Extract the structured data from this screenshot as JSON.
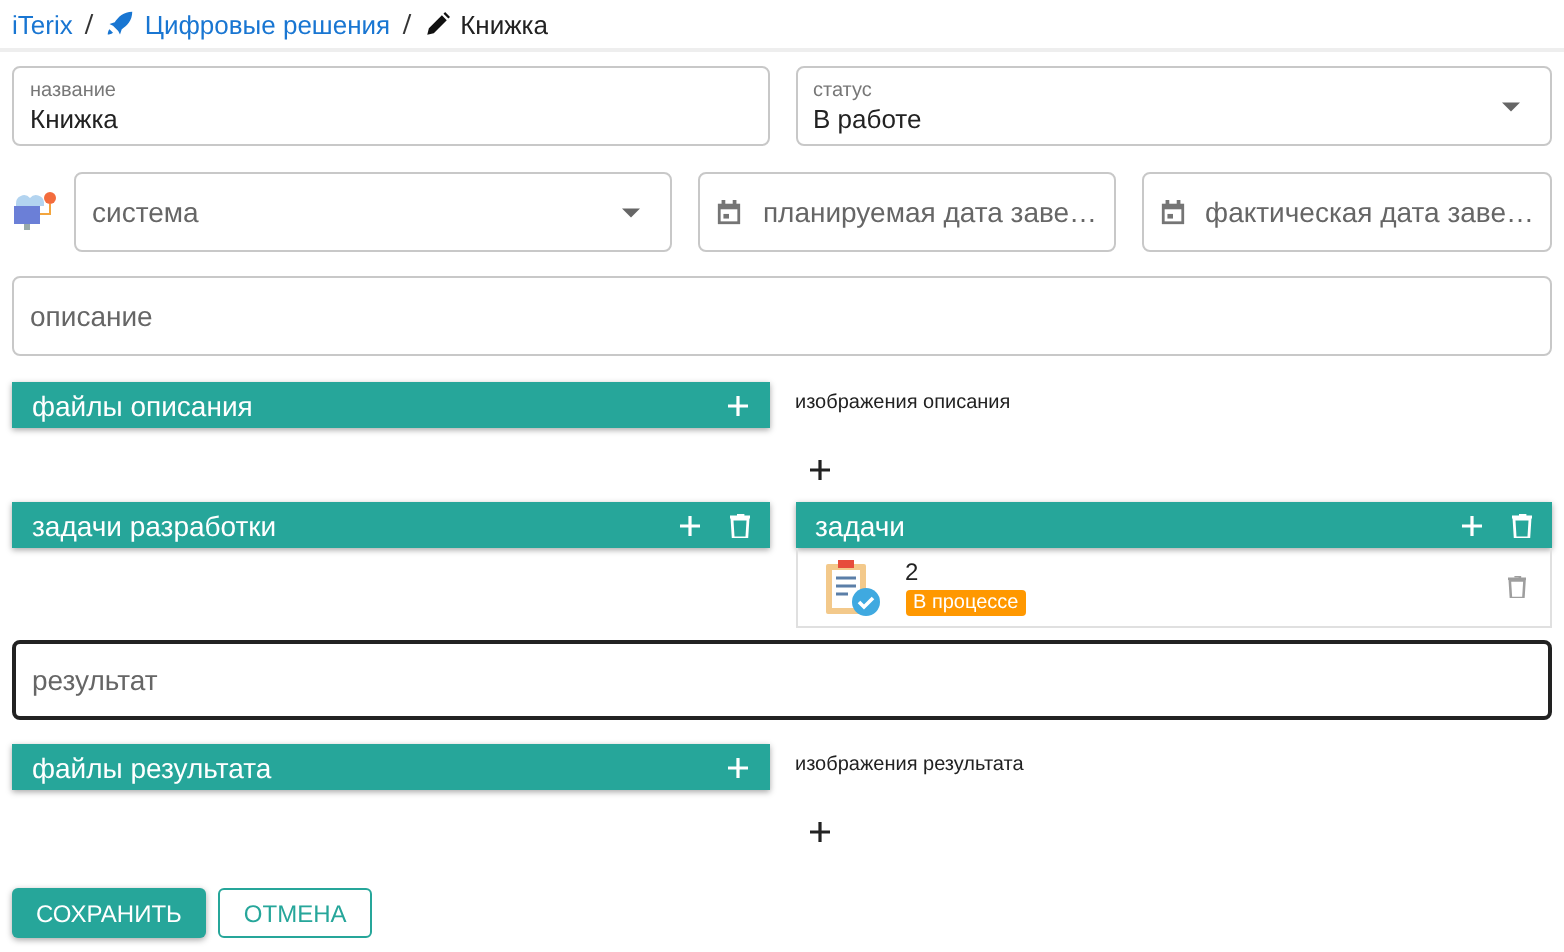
{
  "breadcrumb": [
    {
      "label": "iTerix",
      "kind": "root"
    },
    {
      "label": "Цифровые решения",
      "kind": "section"
    },
    {
      "label": "Книжка",
      "kind": "current"
    }
  ],
  "name_field": {
    "label": "название",
    "value": "Книжка"
  },
  "status_select": {
    "label": "статус",
    "value": "В работе"
  },
  "system_select": {
    "placeholder": "система"
  },
  "planned_date": {
    "placeholder": "планируемая дата заве…"
  },
  "actual_date": {
    "placeholder": "фактическая дата заве…"
  },
  "description": {
    "placeholder": "описание",
    "focused": false
  },
  "description_files": {
    "title": "файлы описания",
    "kind": "files"
  },
  "description_images": {
    "label": "изображения описания"
  },
  "dev_tasks": {
    "title": "задачи разработки",
    "kind": "tasks"
  },
  "tasks": {
    "title": "задачи",
    "kind": "tasks",
    "items": [
      {
        "name": "2",
        "status": "В процессе"
      }
    ]
  },
  "result": {
    "placeholder": "результат",
    "focused": true
  },
  "result_files": {
    "title": "файлы результата",
    "kind": "files"
  },
  "result_images": {
    "label": "изображения результата"
  },
  "buttons": [
    {
      "label": "СОХРАНИТЬ",
      "kind": "primary"
    },
    {
      "label": "ОТМЕНА",
      "kind": "outlined"
    }
  ]
}
